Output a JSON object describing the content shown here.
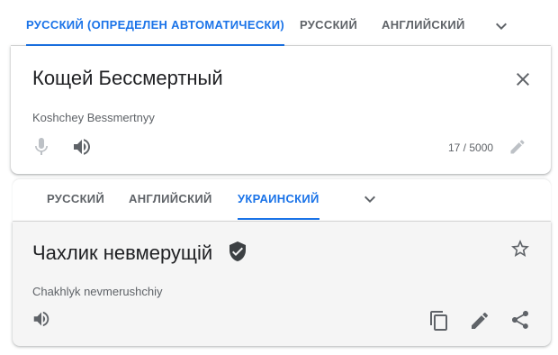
{
  "source": {
    "tabs": [
      {
        "label": "РУССКИЙ (ОПРЕДЕЛЕН АВТОМАТИЧЕСКИ)",
        "active": true
      },
      {
        "label": "РУССКИЙ",
        "active": false
      },
      {
        "label": "АНГЛИЙСКИЙ",
        "active": false
      }
    ],
    "text": "Кощей Бессмертный",
    "transliteration": "Koshchey Bessmertnyy",
    "char_count": "17 / 5000"
  },
  "target": {
    "tabs": [
      {
        "label": "РУССКИЙ",
        "active": false
      },
      {
        "label": "АНГЛИЙСКИЙ",
        "active": false
      },
      {
        "label": "УКРАИНСКИЙ",
        "active": true
      }
    ],
    "text": "Чахлик невмерущій",
    "transliteration": "Chakhlyk nevmerushchiy"
  },
  "icons": [
    "chevron-down-icon",
    "close-icon",
    "microphone-icon",
    "speaker-icon",
    "pencil-icon",
    "verified-icon",
    "star-icon",
    "copy-icon",
    "share-icon"
  ],
  "colors": {
    "accent": "#1a73e8",
    "text": "#202124",
    "muted": "#5f6368",
    "target_bg": "#f5f5f5"
  }
}
